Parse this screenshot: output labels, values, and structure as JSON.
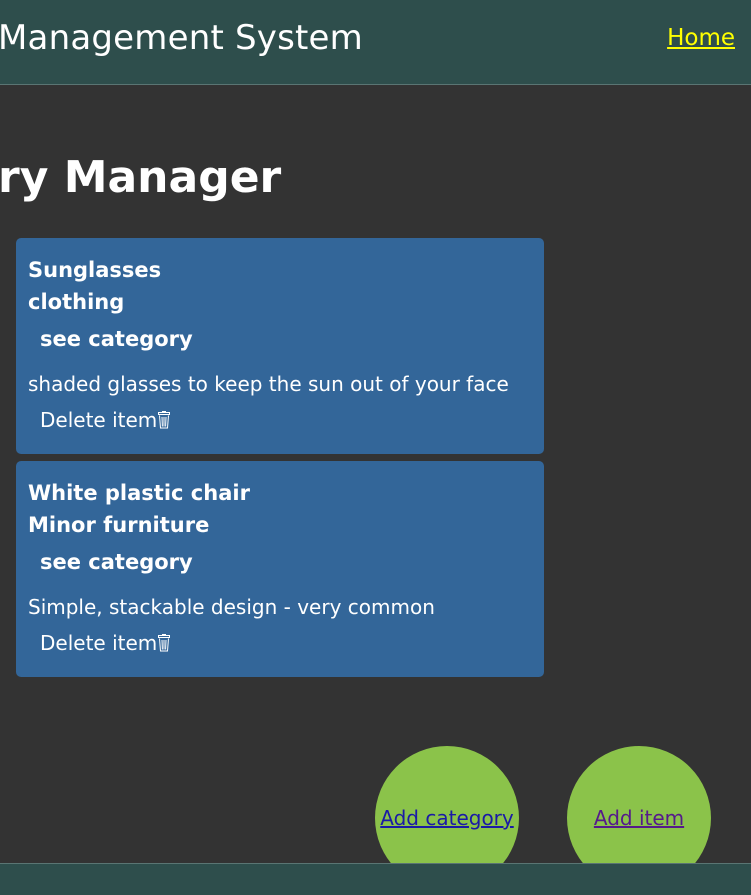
{
  "header": {
    "title": "Management System",
    "home_link": "Home"
  },
  "page_title": "ry Manager",
  "items": [
    {
      "name": "Sunglasses",
      "category": "clothing",
      "see_category_label": "see category",
      "description": "shaded glasses to keep the sun out of your face",
      "delete_label": "Delete item"
    },
    {
      "name": "White plastic chair",
      "category": "Minor furniture",
      "see_category_label": "see category",
      "description": "Simple, stackable design - very common",
      "delete_label": "Delete item"
    }
  ],
  "actions": {
    "add_category": "Add category",
    "add_item": "Add item"
  },
  "colors": {
    "background": "#333333",
    "header": "#2e4e4c",
    "card": "#336699",
    "action_button": "#8bc34a",
    "home_link": "#ffff00"
  },
  "icons": {
    "delete": "trash-icon"
  }
}
